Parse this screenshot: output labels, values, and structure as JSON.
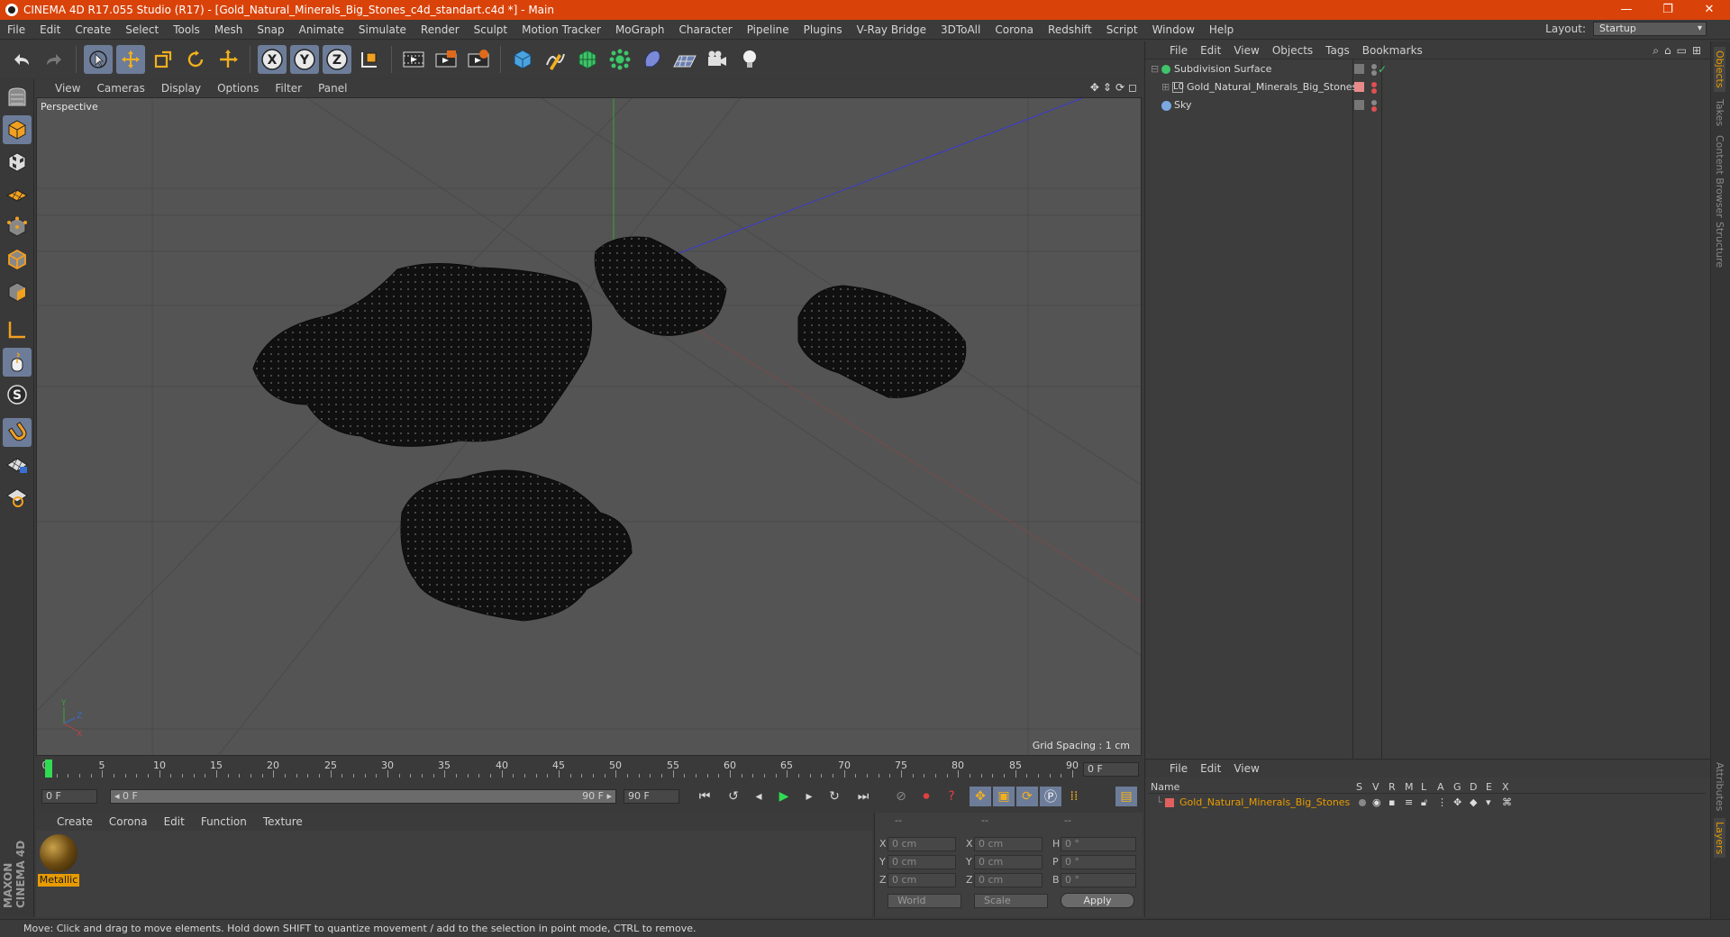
{
  "window": {
    "title": "CINEMA 4D R17.055 Studio (R17) - [Gold_Natural_Minerals_Big_Stones_c4d_standart.c4d *] - Main",
    "controls": [
      "—",
      "❐",
      "✕"
    ]
  },
  "menubar": {
    "items": [
      "File",
      "Edit",
      "Create",
      "Select",
      "Tools",
      "Mesh",
      "Snap",
      "Animate",
      "Simulate",
      "Render",
      "Sculpt",
      "Motion Tracker",
      "MoGraph",
      "Character",
      "Pipeline",
      "Plugins",
      "V-Ray Bridge",
      "3DToAll",
      "Corona",
      "Redshift",
      "Script",
      "Window",
      "Help"
    ],
    "layout_label": "Layout:",
    "layout_value": "Startup"
  },
  "toolbar": {
    "icons": [
      "undo-icon",
      "redo-icon",
      "live-selection-icon",
      "move-icon",
      "scale-icon",
      "rotate-icon",
      "transform-icon",
      "x-axis-icon",
      "y-axis-icon",
      "z-axis-icon",
      "coordinate-system-icon",
      "render-view-icon",
      "render-picture-viewer-icon",
      "edit-render-settings-icon",
      "cube-icon",
      "pen-spline-icon",
      "subdivision-icon",
      "array-icon",
      "deformer-icon",
      "floor-icon",
      "camera-icon",
      "light-icon"
    ],
    "axis_labels": [
      "X",
      "Y",
      "Z"
    ]
  },
  "leftbar": {
    "icons": [
      "make-editable-icon",
      "model-mode-icon",
      "texture-mode-icon",
      "workplane-icon",
      "points-mode-icon",
      "edges-mode-icon",
      "polygons-mode-icon",
      "axis-mode-icon",
      "tweak-mode-icon",
      "snap-icon",
      "magnet-icon",
      "grid-lock-icon",
      "workplane-lock-icon"
    ],
    "brand": "MAXON CINEMA 4D"
  },
  "viewport": {
    "menu": [
      "View",
      "Cameras",
      "Display",
      "Options",
      "Filter",
      "Panel"
    ],
    "label": "Perspective",
    "grid_spacing": "Grid Spacing : 1 cm",
    "axis_labels": [
      "Y",
      "Z",
      "X"
    ]
  },
  "timeline": {
    "ticks": [
      0,
      5,
      10,
      15,
      20,
      25,
      30,
      35,
      40,
      45,
      50,
      55,
      60,
      65,
      70,
      75,
      80,
      85,
      90
    ],
    "current_frame": "0 F",
    "start_frame": "0 F",
    "slider_start": "0 F",
    "slider_end": "90 F",
    "end_frame": "90 F"
  },
  "material_manager": {
    "menu": [
      "Create",
      "Corona",
      "Edit",
      "Function",
      "Texture"
    ],
    "materials": [
      {
        "name": "Metallic"
      }
    ]
  },
  "coordinates": {
    "headers": [
      "--",
      "--",
      "--"
    ],
    "rows": [
      {
        "axis": "X",
        "pos": "0 cm",
        "axis2": "X",
        "size": "0 cm",
        "rot_axis": "H",
        "rot": "0 °"
      },
      {
        "axis": "Y",
        "pos": "0 cm",
        "axis2": "Y",
        "size": "0 cm",
        "rot_axis": "P",
        "rot": "0 °"
      },
      {
        "axis": "Z",
        "pos": "0 cm",
        "axis2": "Z",
        "size": "0 cm",
        "rot_axis": "B",
        "rot": "0 °"
      }
    ],
    "mode_select": "World",
    "size_select": "Scale",
    "apply_label": "Apply"
  },
  "object_manager": {
    "menu": [
      "File",
      "Edit",
      "View",
      "Objects",
      "Tags",
      "Bookmarks"
    ],
    "objects": [
      {
        "name": "Subdivision Surface",
        "icon": "subdivision-icon"
      },
      {
        "name": "Gold_Natural_Minerals_Big_Stones",
        "icon": "null-object-icon"
      },
      {
        "name": "Sky",
        "icon": "sky-icon"
      }
    ],
    "tabs": [
      "Objects",
      "Takes",
      "Content Browser",
      "Structure"
    ]
  },
  "layer_manager": {
    "menu": [
      "File",
      "Edit",
      "View"
    ],
    "columns": [
      "Name",
      "S",
      "V",
      "R",
      "M",
      "L",
      "A",
      "G",
      "D",
      "E",
      "X"
    ],
    "layers": [
      {
        "name": "Gold_Natural_Minerals_Big_Stones",
        "color": "#e06060"
      }
    ],
    "tabs": [
      "Attributes",
      "Layers"
    ]
  },
  "statusbar": {
    "text": "Move: Click and drag to move elements. Hold down SHIFT to quantize movement / add to the selection in point mode, CTRL to remove."
  },
  "colors": {
    "titlebar": "#d9430a",
    "active_tool": "#6d7d99",
    "accent_orange": "#e79b00",
    "viewport_bg": "#545454",
    "playhead": "#2fdc52"
  }
}
